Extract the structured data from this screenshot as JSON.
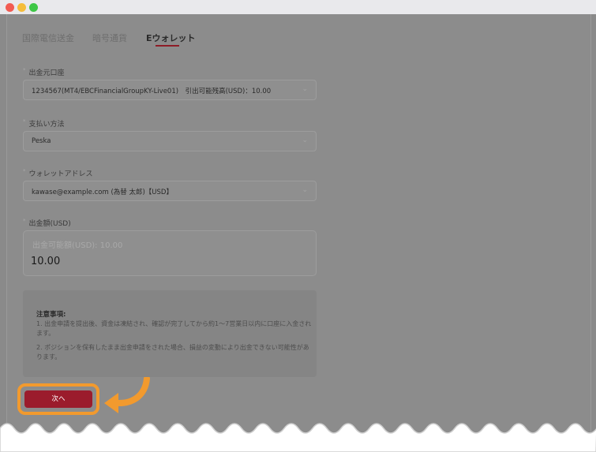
{
  "tabs": [
    {
      "label": "国際電信送金"
    },
    {
      "label": "暗号通貨"
    },
    {
      "label": "Eウォレット",
      "active": true
    }
  ],
  "form": {
    "source_account": {
      "label": "出金元口座",
      "value": "1234567(MT4/EBCFinancialGroupKY-Live01)　引出可能残高(USD)：10.00"
    },
    "payment_method": {
      "label": "支払い方法",
      "value": "Peska"
    },
    "wallet_address": {
      "label": "ウォレットアドレス",
      "value": "kawase@example.com (為替 太郎)【USD】"
    },
    "amount": {
      "label": "出金額(USD)",
      "placeholder": "出金可能額(USD): 10.00",
      "value": "10.00"
    },
    "required_mark": "*"
  },
  "notice": {
    "title": "注意事項:",
    "line1": "1. 出金申請を提出後、資金は凍結され、確認が完了してから約1〜7営業日以内に口座に入金されます。",
    "line2": "2. ポジションを保有したまま出金申請をされた場合、損益の変動により出金できない可能性があります。"
  },
  "next_button": {
    "label": "次へ"
  },
  "colors": {
    "accent": "#9b1c2c",
    "highlight": "#f29a2e",
    "overlay": "#8c8c8c"
  },
  "icons": {
    "dropdown": "chevron-down-icon",
    "pointer": "curved-arrow-icon"
  }
}
